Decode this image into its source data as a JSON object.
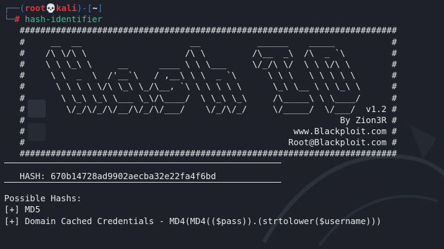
{
  "theme": {
    "background": "#1e2129",
    "text": "#e6e6e6",
    "prompt_frame": "#2f7fdc",
    "prompt_user": "#e8333d",
    "prompt_command": "#3fbf8f"
  },
  "prompt": {
    "frame_top_open": "┌──(",
    "user": "root",
    "skull_icon": "💀",
    "host": "kali",
    "frame_mid": ")-[",
    "cwd": "~",
    "frame_close": "]",
    "frame_bottom": "└─",
    "symbol": "#",
    "command": "hash-identifier"
  },
  "banner": [
    "   #########################################################################",
    "   #     __  __                     __           ______    _____           #",
    "   #    /\\ \\/\\ \\                   /\\ \\         /\\__  _\\  /\\  _ `\\         #",
    "   #    \\ \\ \\_\\ \\     __      ____ \\ \\ \\___     \\/_/\\ \\/  \\ \\ \\/\\ \\        #",
    "   #     \\ \\  _  \\  /'__`\\   / ,__\\ \\ \\  _ `\\      \\ \\ \\   \\ \\ \\ \\ \\       #",
    "   #      \\ \\ \\ \\ \\/\\ \\_\\ \\_/\\__, `\\ \\ \\ \\ \\ \\      \\_\\ \\__ \\ \\ \\_\\ \\      #",
    "   #       \\ \\_\\ \\_\\ \\___ \\_\\/\\____/  \\ \\_\\ \\_\\     /\\_____\\ \\ \\____/      #",
    "   #        \\/_/\\/_/\\/__/\\/_/\\/___/    \\/_/\\/_/     \\/_____/  \\/___/  v1.2 #",
    "   #                                                             By Zion3R #",
    "   #                                                    www.Blackploit.com #",
    "   #                                                   Root@Blackploit.com #",
    "   #########################################################################"
  ],
  "hash_line": "   HASH: 670b14728ad9902aecba32e22fa4f6bd",
  "results_heading": "Possible Hashs:",
  "results": [
    "[+] MD5",
    "[+] Domain Cached Credentials - MD4(MD4(($pass)).(strtolower($username)))"
  ]
}
